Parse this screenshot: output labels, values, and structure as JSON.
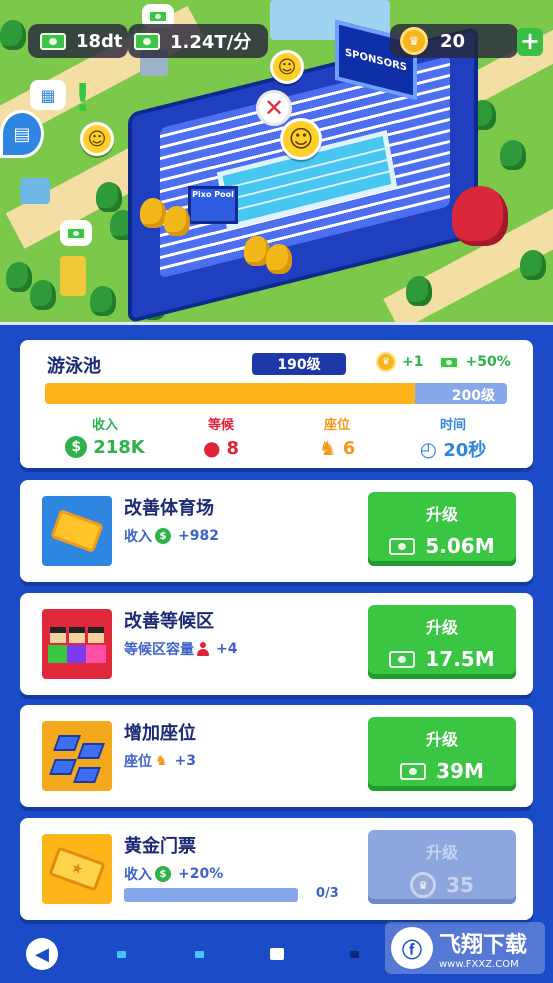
{
  "hud": {
    "cash": "18dt",
    "income_rate": "1.24T/分",
    "trophies": "20",
    "add_label": "+"
  },
  "scene": {
    "sponsor_board": "SPONSORS",
    "entrance_sign": "Pixo Pool"
  },
  "facility": {
    "name": "游泳池",
    "level": "190级",
    "next_level": "200级",
    "progress_fraction": 0.8,
    "reward_trophy": "+1",
    "reward_income": "+50%",
    "stats": [
      {
        "label": "收入",
        "value": "218K",
        "color": "#2db34a"
      },
      {
        "label": "等候",
        "value": "8",
        "color": "#e0233b"
      },
      {
        "label": "座位",
        "value": "6",
        "color": "#f39a1d"
      },
      {
        "label": "时间",
        "value": "20秒",
        "color": "#2f86e0"
      }
    ]
  },
  "upgrades": [
    {
      "title": "改善体育场",
      "sub_label": "收入",
      "sub_value": "+982",
      "button_label": "升级",
      "cost": "5.06M",
      "icon": "ticket-icon",
      "enabled": true
    },
    {
      "title": "改善等候区",
      "sub_label": "等候区容量",
      "sub_value": "+4",
      "button_label": "升级",
      "cost": "17.5M",
      "icon": "crowd-icon",
      "enabled": true
    },
    {
      "title": "增加座位",
      "sub_label": "座位",
      "sub_value": "+3",
      "button_label": "升级",
      "cost": "39M",
      "icon": "seats-icon",
      "enabled": true
    },
    {
      "title": "黄金门票",
      "sub_label": "收入",
      "sub_value": "+20%",
      "button_label": "升级",
      "cost": "35",
      "icon": "gold-ticket-icon",
      "enabled": false,
      "progress": "0/3",
      "progress_fraction": 0.0
    }
  ],
  "watermark": {
    "brand": "飞翔下载",
    "url": "www.FXXZ.COM"
  }
}
